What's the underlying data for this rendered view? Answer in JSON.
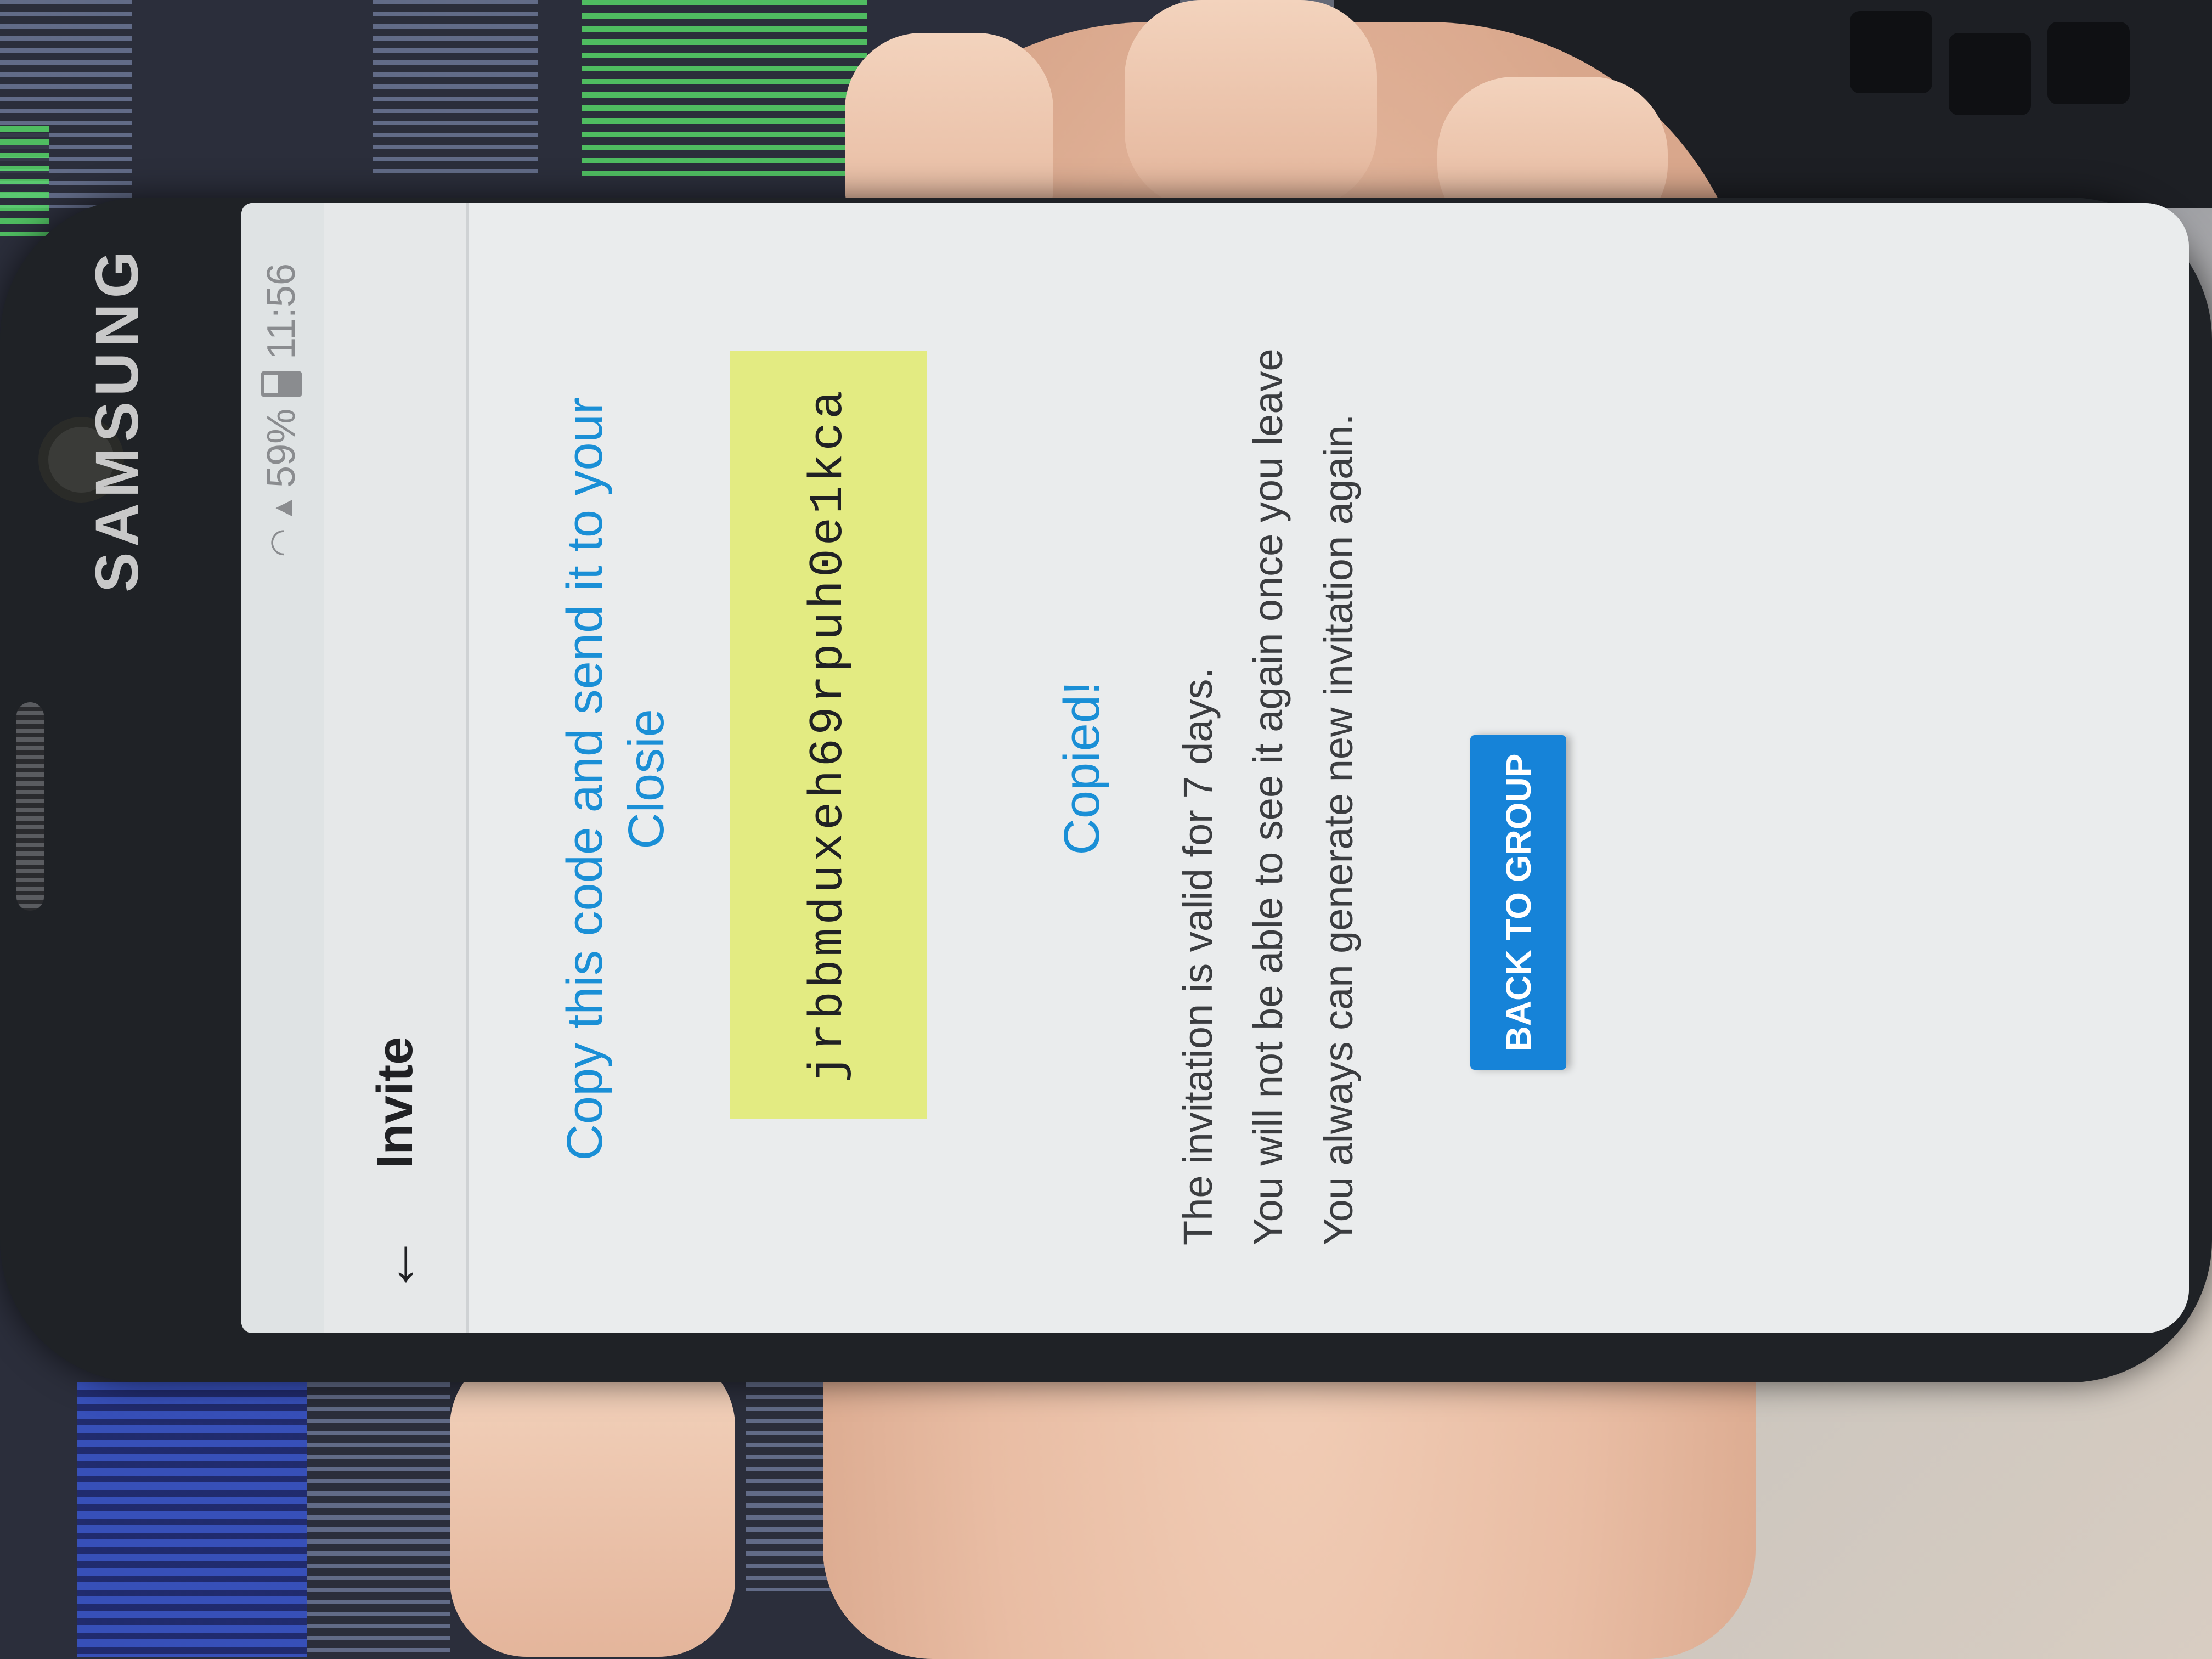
{
  "status_bar": {
    "battery": "59%",
    "time": "11:56"
  },
  "device": {
    "brand": "SAMSUNG"
  },
  "toolbar": {
    "back_icon": "←",
    "title": "Invite"
  },
  "invite": {
    "headline": "Copy this code and send it to your Closie",
    "code": "jrbbmduxeh69rpuh0e1kca",
    "copied_label": "Copied!",
    "info_lines": [
      "The invitation is valid for 7 days.",
      "You will not be able to see it again once you leave",
      "You always can generate new invitation again."
    ],
    "back_button_label": "BACK TO GROUP"
  },
  "colors": {
    "accent": "#1a8fd6",
    "button": "#1683d8",
    "code_highlight": "#e3eb82"
  }
}
